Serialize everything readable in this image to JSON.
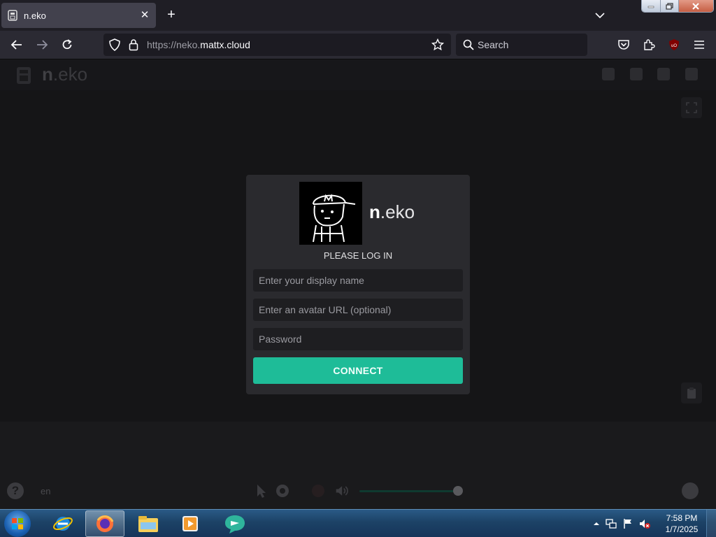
{
  "browser": {
    "tab_title": "n.eko",
    "url_prefix": "https://neko.",
    "url_domain": "mattx.cloud",
    "search_placeholder": "Search"
  },
  "app": {
    "logo_bold": "n",
    "logo_rest": ".eko",
    "language": "en"
  },
  "login": {
    "brand_bold": "n",
    "brand_rest": ".eko",
    "heading": "PLEASE LOG IN",
    "display_name_placeholder": "Enter your display name",
    "avatar_url_placeholder": "Enter an avatar URL (optional)",
    "password_placeholder": "Password",
    "connect_label": "CONNECT",
    "accent_color": "#1ebc98"
  },
  "taskbar": {
    "time": "7:58 PM",
    "date": "1/7/2025"
  }
}
